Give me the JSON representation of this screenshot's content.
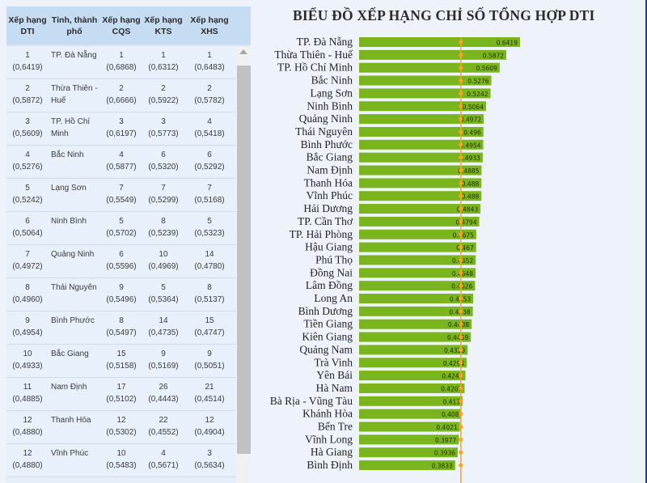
{
  "table": {
    "headers": [
      "Xếp hạng DTI",
      "Tỉnh, thành phố",
      "Xếp hạng CQS",
      "Xếp hạng KTS",
      "Xếp hạng XHS"
    ],
    "rows": [
      {
        "dti_rank": "1",
        "dti_score": "(0,6419)",
        "province": "TP. Đà Nẵng",
        "cqs_rank": "1",
        "cqs_score": "(0,6868)",
        "kts_rank": "1",
        "kts_score": "(0,6312)",
        "xhs_rank": "1",
        "xhs_score": "(0,6483)"
      },
      {
        "dti_rank": "2",
        "dti_score": "(0,5872)",
        "province": "Thừa Thiên - Huế",
        "cqs_rank": "2",
        "cqs_score": "(0,6666)",
        "kts_rank": "2",
        "kts_score": "(0,5922)",
        "xhs_rank": "2",
        "xhs_score": "(0,5782)"
      },
      {
        "dti_rank": "3",
        "dti_score": "(0,5609)",
        "province": "TP. Hồ Chí Minh",
        "cqs_rank": "3",
        "cqs_score": "(0,6197)",
        "kts_rank": "3",
        "kts_score": "(0,5773)",
        "xhs_rank": "4",
        "xhs_score": "(0,5418)"
      },
      {
        "dti_rank": "4",
        "dti_score": "(0,5276)",
        "province": "Bắc Ninh",
        "cqs_rank": "4",
        "cqs_score": "(0,5877)",
        "kts_rank": "6",
        "kts_score": "(0,5320)",
        "xhs_rank": "6",
        "xhs_score": "(0,5292)"
      },
      {
        "dti_rank": "5",
        "dti_score": "(0,5242)",
        "province": "Lạng Sơn",
        "cqs_rank": "7",
        "cqs_score": "(0,5549)",
        "kts_rank": "7",
        "kts_score": "(0,5299)",
        "xhs_rank": "7",
        "xhs_score": "(0,5168)"
      },
      {
        "dti_rank": "6",
        "dti_score": "(0,5064)",
        "province": "Ninh Bình",
        "cqs_rank": "5",
        "cqs_score": "(0,5702)",
        "kts_rank": "8",
        "kts_score": "(0,5239)",
        "xhs_rank": "5",
        "xhs_score": "(0,5323)"
      },
      {
        "dti_rank": "7",
        "dti_score": "(0,4972)",
        "province": "Quảng Ninh",
        "cqs_rank": "6",
        "cqs_score": "(0,5596)",
        "kts_rank": "10",
        "kts_score": "(0,4969)",
        "xhs_rank": "14",
        "xhs_score": "(0,4780)"
      },
      {
        "dti_rank": "8",
        "dti_score": "(0,4960)",
        "province": "Thái Nguyên",
        "cqs_rank": "9",
        "cqs_score": "(0,5496)",
        "kts_rank": "5",
        "kts_score": "(0,5364)",
        "xhs_rank": "8",
        "xhs_score": "(0,5137)"
      },
      {
        "dti_rank": "9",
        "dti_score": "(0,4954)",
        "province": "Bình Phước",
        "cqs_rank": "8",
        "cqs_score": "(0,5497)",
        "kts_rank": "14",
        "kts_score": "(0,4735)",
        "xhs_rank": "15",
        "xhs_score": "(0,4747)"
      },
      {
        "dti_rank": "10",
        "dti_score": "(0,4933)",
        "province": "Bắc Giang",
        "cqs_rank": "15",
        "cqs_score": "(0,5158)",
        "kts_rank": "9",
        "kts_score": "(0,5169)",
        "xhs_rank": "9",
        "xhs_score": "(0,5051)"
      },
      {
        "dti_rank": "11",
        "dti_score": "(0,4885)",
        "province": "Nam Định",
        "cqs_rank": "17",
        "cqs_score": "(0,5102)",
        "kts_rank": "26",
        "kts_score": "(0,4443)",
        "xhs_rank": "21",
        "xhs_score": "(0,4514)"
      },
      {
        "dti_rank": "12",
        "dti_score": "(0,4880)",
        "province": "Thanh Hóa",
        "cqs_rank": "12",
        "cqs_score": "(0,5302)",
        "kts_rank": "22",
        "kts_score": "(0,4552)",
        "xhs_rank": "12",
        "xhs_score": "(0,4904)"
      },
      {
        "dti_rank": "12",
        "dti_score": "(0,4880)",
        "province": "Vĩnh Phúc",
        "cqs_rank": "10",
        "cqs_score": "(0,5483)",
        "kts_rank": "4",
        "kts_score": "(0,5671)",
        "xhs_rank": "3",
        "xhs_score": "(0,5634)"
      }
    ]
  },
  "chart_data": {
    "type": "bar",
    "orientation": "horizontal",
    "title": "BIỂU ĐỒ XẾP HẠNG CHỈ SỐ TỔNG HỢP DTI",
    "xlabel": "",
    "ylabel": "",
    "bar_color": "#7ab51d",
    "reference_line_color": "#f5a623",
    "reference_line_value": 0.406,
    "grid": false,
    "categories": [
      "TP. Đà Nẵng",
      "Thừa Thiên - Huế",
      "TP. Hồ Chí Minh",
      "Bắc Ninh",
      "Lạng Sơn",
      "Ninh Bình",
      "Quảng Ninh",
      "Thái Nguyên",
      "Bình Phước",
      "Bắc Giang",
      "Nam Định",
      "Thanh Hóa",
      "Vĩnh Phúc",
      "Hải Dương",
      "TP. Cần Thơ",
      "TP. Hải Phòng",
      "Hậu Giang",
      "Phú Thọ",
      "Đồng Nai",
      "Lâm Đồng",
      "Long An",
      "Bình Dương",
      "Tiền Giang",
      "Kiên Giang",
      "Quảng Nam",
      "Trà Vinh",
      "Yên Bái",
      "Hà Nam",
      "Bà Rịa - Vũng Tàu",
      "Khánh Hòa",
      "Bến Tre",
      "Vĩnh Long",
      "Hà Giang",
      "Bình Định"
    ],
    "values": [
      0.6419,
      0.5872,
      0.5609,
      0.5276,
      0.5242,
      0.5064,
      0.4972,
      0.496,
      0.4954,
      0.4933,
      0.4885,
      0.488,
      0.488,
      0.4843,
      0.4794,
      0.4675,
      0.467,
      0.4652,
      0.4648,
      0.4626,
      0.4553,
      0.4538,
      0.4488,
      0.4459,
      0.4329,
      0.4294,
      0.4241,
      0.4207,
      0.413,
      0.408,
      0.4021,
      0.3977,
      0.3936,
      0.3833
    ],
    "labels": [
      "0.6419",
      "0.5872",
      "0.5609",
      "0.5276",
      "0.5242",
      "0.5064",
      "0.4972",
      "0.496",
      "0.4954",
      "0.4933",
      "0.4885",
      "0.488",
      "0.488",
      "0.4843",
      "0.4794",
      "0.4675",
      "0.467",
      "0.4652",
      "0.4648",
      "0.4626",
      "0.4553",
      "0.4538",
      "0.4488",
      "0.4459",
      "0.4329",
      "0.4294",
      "0.4241",
      "0.4207",
      "0.413",
      "0.408",
      "0.4021",
      "0.3977",
      "0.3936",
      "0.3833"
    ]
  }
}
